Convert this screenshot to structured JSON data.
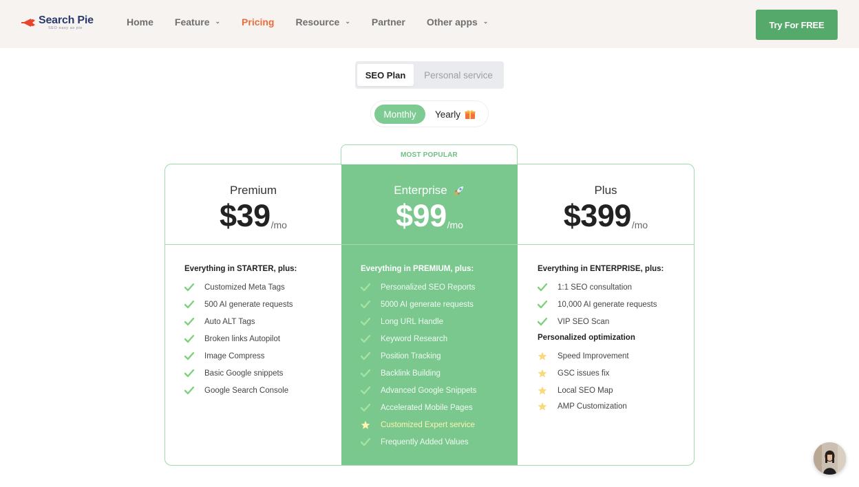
{
  "header": {
    "logo_name": "Search Pie",
    "logo_tagline": "SEO easy as pie",
    "nav": [
      {
        "label": "Home",
        "has_dropdown": false,
        "active": false
      },
      {
        "label": "Feature",
        "has_dropdown": true,
        "active": false
      },
      {
        "label": "Pricing",
        "has_dropdown": false,
        "active": true
      },
      {
        "label": "Resource",
        "has_dropdown": true,
        "active": false
      },
      {
        "label": "Partner",
        "has_dropdown": false,
        "active": false
      },
      {
        "label": "Other apps",
        "has_dropdown": true,
        "active": false
      }
    ],
    "cta_label": "Try For FREE"
  },
  "plan_toggle": {
    "active": "SEO Plan",
    "inactive": "Personal service"
  },
  "billing_toggle": {
    "monthly": "Monthly",
    "yearly": "Yearly"
  },
  "badge": "MOST POPULAR",
  "plans": [
    {
      "name": "Premium",
      "price": "$39",
      "unit": "/mo",
      "heading": "Everything in STARTER, plus:",
      "features": [
        {
          "text": "Customized Meta Tags",
          "icon": "check"
        },
        {
          "text": "500 AI generate requests",
          "icon": "check"
        },
        {
          "text": "Auto ALT Tags",
          "icon": "check"
        },
        {
          "text": "Broken links Autopilot",
          "icon": "check"
        },
        {
          "text": "Image Compress",
          "icon": "check"
        },
        {
          "text": "Basic Google snippets",
          "icon": "check"
        },
        {
          "text": "Google Search Console",
          "icon": "check"
        }
      ]
    },
    {
      "name": "Enterprise",
      "price": "$99",
      "unit": "/mo",
      "heading": "Everything in PREMIUM, plus:",
      "features": [
        {
          "text": "Personalized SEO Reports",
          "icon": "check"
        },
        {
          "text": "5000 AI generate requests",
          "icon": "check"
        },
        {
          "text": "Long URL Handle",
          "icon": "check"
        },
        {
          "text": "Keyword Research",
          "icon": "check"
        },
        {
          "text": "Position Tracking",
          "icon": "check"
        },
        {
          "text": "Backlink Building",
          "icon": "check"
        },
        {
          "text": "Advanced Google Snippets",
          "icon": "check"
        },
        {
          "text": "Accelerated Mobile Pages",
          "icon": "check"
        },
        {
          "text": "Customized Expert service",
          "icon": "star"
        },
        {
          "text": "Frequently Added Values",
          "icon": "check"
        }
      ]
    },
    {
      "name": "Plus",
      "price": "$399",
      "unit": "/mo",
      "heading": "Everything in ENTERPRISE, plus:",
      "features": [
        {
          "text": "1:1 SEO consultation",
          "icon": "check"
        },
        {
          "text": "10,000 AI generate requests",
          "icon": "check"
        },
        {
          "text": "VIP SEO Scan",
          "icon": "check"
        }
      ],
      "subheading": "Personalized optimization",
      "sub_features": [
        {
          "text": "Speed Improvement",
          "icon": "star"
        },
        {
          "text": "GSC issues fix",
          "icon": "star"
        },
        {
          "text": "Local SEO Map",
          "icon": "star"
        },
        {
          "text": "AMP Customization",
          "icon": "star"
        }
      ]
    }
  ],
  "colors": {
    "accent_green": "#55a96a",
    "card_green": "#7ac88e",
    "active_nav": "#ee6b3a",
    "check_green": "#7dd17a",
    "star_yellow": "#f9d97a"
  }
}
